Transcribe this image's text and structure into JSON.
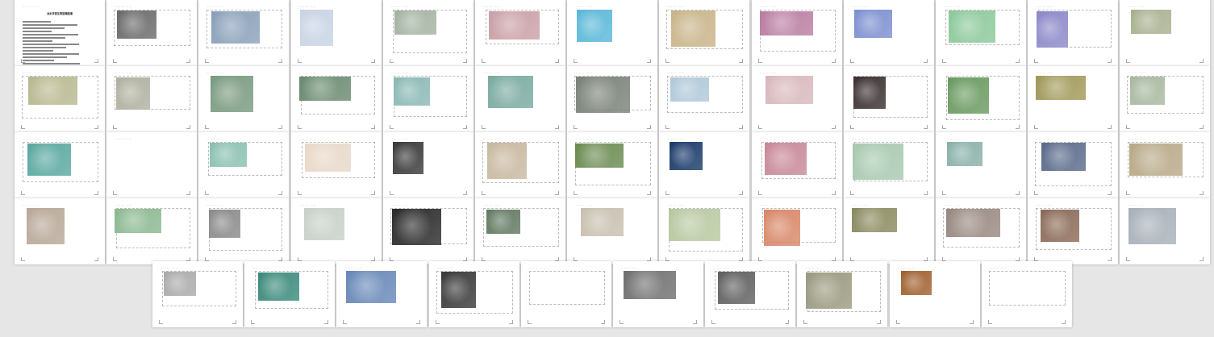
{
  "header_text": "— — —  · — —",
  "doc_title": "淡水浮游生物显微图谱",
  "pages": [
    {
      "img": "radiolarian-cell",
      "c": "#6a6a6a"
    },
    {
      "img": "diatom-cluster",
      "c": "#8aa0b8"
    },
    {
      "img": "ciliate-sketch",
      "c": "#c8d4e4"
    },
    {
      "img": "round-cell",
      "c": "#a4b2a2"
    },
    {
      "img": "pink-cells",
      "c": "#c9a0a6"
    },
    {
      "img": "blue-colony",
      "c": "#5bb8d8"
    },
    {
      "img": "rod-bacteria",
      "c": "#c9b48a"
    },
    {
      "img": "oval-organisms",
      "c": "#b97da0"
    },
    {
      "img": "mixed-cells",
      "c": "#7c8fcf"
    },
    {
      "img": "paramecium",
      "c": "#8cc89a"
    },
    {
      "img": "purple-sphere",
      "c": "#8c88c8"
    },
    {
      "img": "dark-spheres",
      "c": "#a8b090"
    },
    {
      "img": "rotifer",
      "c": "#b8b890"
    },
    {
      "img": "ciliate-field",
      "c": "#b0b0a0"
    },
    {
      "img": "green-field",
      "c": "#7a9a80"
    },
    {
      "img": "green-plate",
      "c": "#6a8a70"
    },
    {
      "img": "teal-algae",
      "c": "#8ab8b4"
    },
    {
      "img": "teal-debris",
      "c": "#7aaaa0"
    },
    {
      "img": "dark-cell",
      "c": "#7a8278"
    },
    {
      "img": "flagellate",
      "c": "#b0c8d8"
    },
    {
      "img": "pink-worm",
      "c": "#d8b8bc"
    },
    {
      "img": "dark-larva",
      "c": "#3a3030"
    },
    {
      "img": "green-bundle",
      "c": "#6a9a60"
    },
    {
      "img": "brown-filament",
      "c": "#a09858"
    },
    {
      "img": "thin-filament",
      "c": "#a8b8a0"
    },
    {
      "img": "nematode-teal",
      "c": "#5aa8a0"
    },
    {
      "img": "empty-frame",
      "c": ""
    },
    {
      "img": "teal-wide",
      "c": "#8ac0b0"
    },
    {
      "img": "shell-sketch",
      "c": "#e8d8c8"
    },
    {
      "img": "black-specimens",
      "c": "#3a3a3a"
    },
    {
      "img": "brown-debris",
      "c": "#c8b8a0"
    },
    {
      "img": "green-stem",
      "c": "#6a8a50"
    },
    {
      "img": "blue-glow",
      "c": "#1a3a6a"
    },
    {
      "img": "pink-sac",
      "c": "#c88898"
    },
    {
      "img": "pale-green",
      "c": "#a8c8b0"
    },
    {
      "img": "teal-clusters",
      "c": "#8ab0a8"
    },
    {
      "img": "blue-brown",
      "c": "#5a6a8a"
    },
    {
      "img": "tan-mass",
      "c": "#b8a888"
    },
    {
      "img": "mite",
      "c": "#b8a898"
    },
    {
      "img": "green-haze",
      "c": "#8ab890"
    },
    {
      "img": "grey-plants",
      "c": "#8a8a8a"
    },
    {
      "img": "glass-rod",
      "c": "#c8d0c8"
    },
    {
      "img": "black-crustacean",
      "c": "#2a2a2a"
    },
    {
      "img": "green-yellow",
      "c": "#607860"
    },
    {
      "img": "beige-worm",
      "c": "#c8c0b0"
    },
    {
      "img": "cyst-field",
      "c": "#b8c8a0"
    },
    {
      "img": "orange-cells",
      "c": "#d88868"
    },
    {
      "img": "olive-cells",
      "c": "#8a8a60"
    },
    {
      "img": "grey-brown",
      "c": "#988880"
    },
    {
      "img": "brown-dense",
      "c": "#8a6a58"
    },
    {
      "img": "stalked-cell",
      "c": "#a8b0b8"
    },
    {
      "img": "dual-gray",
      "c": "#aaaaaa"
    },
    {
      "img": "fiber-teal",
      "c": "#3a8a7a"
    },
    {
      "img": "blue-cells",
      "c": "#6888b8"
    },
    {
      "img": "circle-view",
      "c": "#3a3a3a"
    },
    {
      "img": "text-only",
      "c": ""
    },
    {
      "img": "fiber-net",
      "c": "#707070"
    },
    {
      "img": "small-dark",
      "c": "#606060"
    },
    {
      "img": "olive-field",
      "c": "#9a9a80"
    },
    {
      "img": "brown-seeds",
      "c": "#a06030"
    },
    {
      "img": "blank-end",
      "c": ""
    }
  ]
}
